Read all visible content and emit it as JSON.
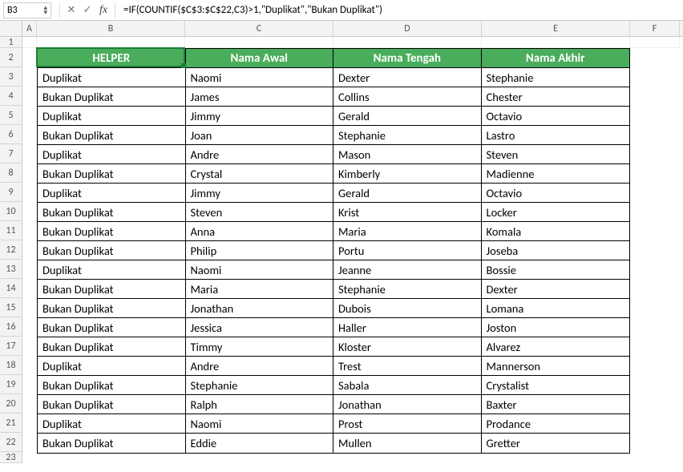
{
  "namebox": {
    "value": "B3"
  },
  "formula": {
    "value": "=IF(COUNTIF($C$3:$C$22,C3)>1,\"Duplikat\",\"Bukan Duplikat\")"
  },
  "columns": {
    "A": "A",
    "B": "B",
    "C": "C",
    "D": "D",
    "E": "E",
    "F": "F"
  },
  "rownums": [
    "1",
    "2",
    "3",
    "4",
    "5",
    "6",
    "7",
    "8",
    "9",
    "10",
    "11",
    "12",
    "13",
    "14",
    "15",
    "16",
    "17",
    "18",
    "19",
    "20",
    "21",
    "22",
    "23"
  ],
  "headers": {
    "b": "HELPER",
    "c": "Nama Awal",
    "d": "Nama Tengah",
    "e": "Nama Akhir"
  },
  "rows": [
    {
      "b": "Duplikat",
      "c": "Naomi",
      "d": "Dexter",
      "e": "Stephanie"
    },
    {
      "b": "Bukan Duplikat",
      "c": "James",
      "d": "Collins",
      "e": "Chester"
    },
    {
      "b": "Duplikat",
      "c": "Jimmy",
      "d": "Gerald",
      "e": "Octavio"
    },
    {
      "b": "Bukan Duplikat",
      "c": "Joan",
      "d": "Stephanie",
      "e": "Lastro"
    },
    {
      "b": "Duplikat",
      "c": "Andre",
      "d": "Mason",
      "e": "Steven"
    },
    {
      "b": "Bukan Duplikat",
      "c": "Crystal",
      "d": "Kimberly",
      "e": "Madienne"
    },
    {
      "b": "Duplikat",
      "c": "Jimmy",
      "d": "Gerald",
      "e": "Octavio"
    },
    {
      "b": "Bukan Duplikat",
      "c": "Steven",
      "d": "Krist",
      "e": "Locker"
    },
    {
      "b": "Bukan Duplikat",
      "c": "Anna",
      "d": "Maria",
      "e": "Komala"
    },
    {
      "b": "Bukan Duplikat",
      "c": "Philip",
      "d": "Portu",
      "e": "Joseba"
    },
    {
      "b": "Duplikat",
      "c": "Naomi",
      "d": "Jeanne",
      "e": "Bossie"
    },
    {
      "b": "Bukan Duplikat",
      "c": "Maria",
      "d": "Stephanie",
      "e": "Dexter"
    },
    {
      "b": "Bukan Duplikat",
      "c": "Jonathan",
      "d": "Dubois",
      "e": "Lomana"
    },
    {
      "b": "Bukan Duplikat",
      "c": "Jessica",
      "d": "Haller",
      "e": "Joston"
    },
    {
      "b": "Bukan Duplikat",
      "c": "Timmy",
      "d": "Kloster",
      "e": "Alvarez"
    },
    {
      "b": "Duplikat",
      "c": "Andre",
      "d": "Trest",
      "e": "Mannerson"
    },
    {
      "b": "Bukan Duplikat",
      "c": "Stephanie",
      "d": "Sabala",
      "e": "Crystalist"
    },
    {
      "b": "Bukan Duplikat",
      "c": "Ralph",
      "d": "Jonathan",
      "e": "Baxter"
    },
    {
      "b": "Duplikat",
      "c": "Naomi",
      "d": "Prost",
      "e": "Prodance"
    },
    {
      "b": "Bukan Duplikat",
      "c": "Eddie",
      "d": "Mullen",
      "e": "Gretter"
    }
  ],
  "colors": {
    "header_bg": "#4aad5b",
    "active_border": "#1a7f37"
  }
}
